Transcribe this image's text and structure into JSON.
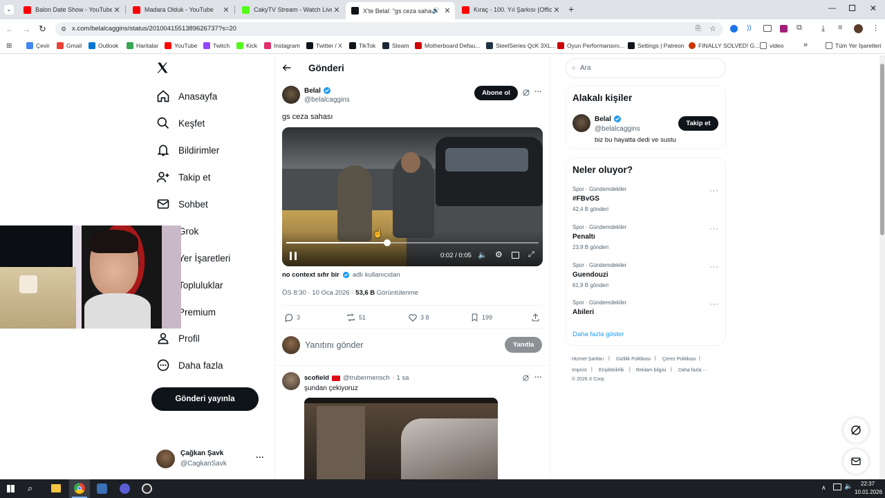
{
  "browser": {
    "tabs": [
      {
        "title": "Balon Date Show - YouTube",
        "fav_color": "#ff0000"
      },
      {
        "title": "Madara Olduk - YouTube",
        "fav_color": "#ff0000"
      },
      {
        "title": "CakyTV Stream - Watch Live on",
        "fav_color": "#53fc18"
      },
      {
        "title": "X'te Belal: \"gs ceza sahası\" #",
        "fav_color": "#0f1419"
      },
      {
        "title": "Kıraç - 100. Yıl Şarkısı (Official V",
        "fav_color": "#ff0000"
      }
    ],
    "new_tab": "+",
    "url": "x.com/belalcaggins/status/2010041551389626737?s=20",
    "bookmarks": [
      {
        "label": "Çevir",
        "color": "#4285f4"
      },
      {
        "label": "Gmail",
        "color": "#ea4335"
      },
      {
        "label": "Outlook",
        "color": "#0078d4"
      },
      {
        "label": "Haritalar",
        "color": "#34a853"
      },
      {
        "label": "YouTube",
        "color": "#ff0000"
      },
      {
        "label": "Twitch",
        "color": "#9146ff"
      },
      {
        "label": "Kick",
        "color": "#53fc18"
      },
      {
        "label": "Instagram",
        "color": "#e1306c"
      },
      {
        "label": "Twitter / X",
        "color": "#0f1419"
      },
      {
        "label": "TikTok",
        "color": "#0f1419"
      },
      {
        "label": "Steam",
        "color": "#1b2838"
      },
      {
        "label": "Motherboard Defau...",
        "color": "#cc0000"
      },
      {
        "label": "SteelSeries QcK 3XL...",
        "color": "#223344"
      },
      {
        "label": "Oyun Performansını...",
        "color": "#cc0000"
      },
      {
        "label": "Settings | Patreon",
        "color": "#0f1419"
      },
      {
        "label": "FINALLY SOLVED! G...",
        "color": "#cc3300"
      },
      {
        "label": "video",
        "color": "#5f6368"
      }
    ],
    "bookmarks_more": "»",
    "all_bookmarks": "Tüm Yer İşaretleri"
  },
  "sidebar": {
    "items": [
      {
        "label": "Anasayfa",
        "icon": "home-icon"
      },
      {
        "label": "Keşfet",
        "icon": "search-icon"
      },
      {
        "label": "Bildirimler",
        "icon": "bell-icon"
      },
      {
        "label": "Takip et",
        "icon": "follow-icon"
      },
      {
        "label": "Sohbet",
        "icon": "mail-icon"
      },
      {
        "label": "Grok",
        "icon": "grok-icon"
      },
      {
        "label": "Yer İşaretleri",
        "icon": "bookmark-icon"
      },
      {
        "label": "Topluluklar",
        "icon": "communities-icon"
      },
      {
        "label": "Premium",
        "icon": "premium-icon"
      },
      {
        "label": "Profil",
        "icon": "profile-icon"
      },
      {
        "label": "Daha fazla",
        "icon": "more-icon"
      }
    ],
    "post_button": "Gönderi yayınla",
    "account_name": "Çağkan Şavk",
    "account_handle": "@CagkanSavk",
    "account_more": "···"
  },
  "post": {
    "header": "Gönderi",
    "author_name": "Belal",
    "author_handle": "@belalcaggins",
    "subscribe": "Abone ol",
    "more": "···",
    "text": "gs ceza sahası",
    "video": {
      "time": "0:02 / 0:05",
      "progress": 0.4
    },
    "source_name": "no context sıfır bir",
    "source_suffix": "adlı kullanıcıdan",
    "timestamp": "ÖS 8:30 · 10 Oca 2026 · ",
    "views_count": "53,6 B",
    "views_label": " Görüntülenme",
    "replies": "3",
    "reposts": "51",
    "likes": "3 8",
    "bookmarks": "199",
    "reply_placeholder": "Yanıtını gönder",
    "reply_button": "Yanıtla"
  },
  "reply": {
    "name": "scofield",
    "handle": "@trubermensch",
    "time": "· 1 sa",
    "text": "şundan çekiyoruz",
    "more": "···"
  },
  "right": {
    "search_placeholder": "Ara",
    "relevant_title": "Alakalı kişiler",
    "person_name": "Belal",
    "person_handle": "@belalcaggins",
    "person_bio": "biz bu hayatta dedi ve sustu",
    "follow_button": "Takip et",
    "trends_title": "Neler oluyor?",
    "trends": [
      {
        "category": "Spor · Gündemdekiler",
        "name": "#FBvGS",
        "count": "42,4 B gönderi"
      },
      {
        "category": "Spor · Gündemdekiler",
        "name": "Penaltı",
        "count": "23,9 B gönderi"
      },
      {
        "category": "Spor · Gündemdekiler",
        "name": "Guendouzi",
        "count": "61,9 B gönderi"
      },
      {
        "category": "Spor · Gündemdekiler",
        "name": "Abileri",
        "count": ""
      }
    ],
    "trend_more": "···",
    "show_more": "Daha fazla göster",
    "footer": [
      "Hizmet Şartları",
      "Gizlilik Politikası",
      "Çerez Politikası",
      "Imprint",
      "Erişilebilirlik",
      "Reklam bilgisi",
      "Daha fazla ···",
      "© 2026 X Corp."
    ]
  },
  "taskbar": {
    "time": "22:37",
    "date": "10.01.2026"
  },
  "colors": {
    "verified": "#1d9bf0",
    "link": "#1d9bf0",
    "taskbar": "#1c1f24"
  }
}
